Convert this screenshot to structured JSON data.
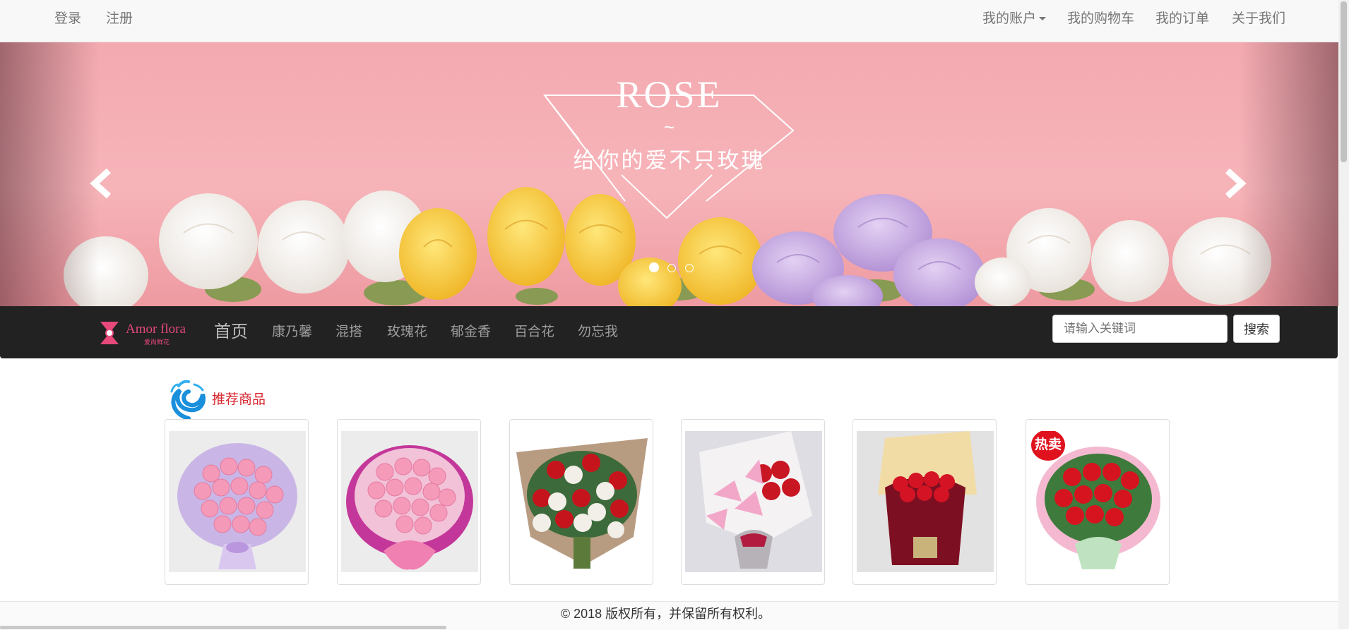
{
  "topbar": {
    "login": "登录",
    "register": "注册",
    "account": "我的账户",
    "cart": "我的购物车",
    "orders": "我的订单",
    "about": "关于我们"
  },
  "carousel": {
    "title": "ROSE",
    "tilde": "~",
    "subtitle": "给你的爱不只玫瑰",
    "slides": 3,
    "active_slide": 1
  },
  "navbar": {
    "logo_text": "Amor flora",
    "logo_sub": "爱尚鲜花",
    "items": [
      "首页",
      "康乃馨",
      "混搭",
      "玫瑰花",
      "郁金香",
      "百合花",
      "勿忘我"
    ],
    "search_placeholder": "请输入关键词",
    "search_button": "搜索"
  },
  "recommended": {
    "title": "推荐商品",
    "products": [
      {
        "kind": "pink carnation bouquet"
      },
      {
        "kind": "pink carnation bouquet"
      },
      {
        "kind": "red and white rose bouquet"
      },
      {
        "kind": "lily and red rose bouquet"
      },
      {
        "kind": "red rose box"
      },
      {
        "kind": "red rose bouquet",
        "badge": "热卖"
      }
    ]
  },
  "footer": {
    "copyright": "© 2018 版权所有，并保留所有权利。"
  },
  "colors": {
    "topbar_bg": "#f8f8f8",
    "navbar_bg": "#222222",
    "accent_red": "#d6252d",
    "brand_pink": "#e6497a",
    "banner_pink": "#f6b4b9"
  }
}
